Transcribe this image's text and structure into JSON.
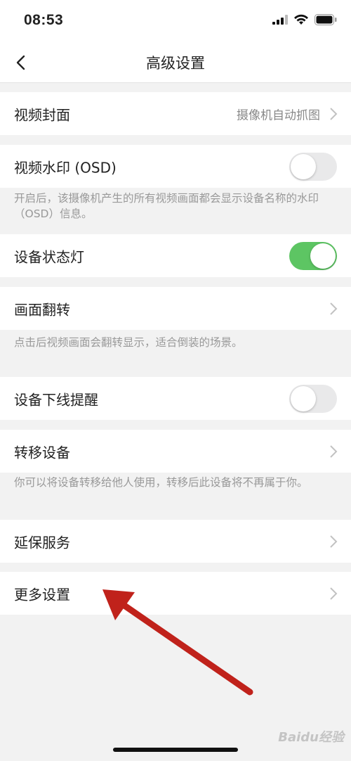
{
  "status_bar": {
    "time": "08:53"
  },
  "nav": {
    "title": "高级设置"
  },
  "rows": {
    "cover": {
      "label": "视频封面",
      "value": "摄像机自动抓图"
    },
    "watermark": {
      "label": "视频水印 (OSD)",
      "enabled": false,
      "note": "开启后，该摄像机产生的所有视频画面都会显示设备名称的水印（OSD）信息。"
    },
    "status_light": {
      "label": "设备状态灯",
      "enabled": true
    },
    "flip": {
      "label": "画面翻转",
      "note": "点击后视频画面会翻转显示，适合倒装的场景。"
    },
    "offline_alert": {
      "label": "设备下线提醒",
      "enabled": false
    },
    "transfer": {
      "label": "转移设备",
      "note": "你可以将设备转移给他人使用，转移后此设备将不再属于你。"
    },
    "warranty": {
      "label": "延保服务"
    },
    "more": {
      "label": "更多设置"
    }
  },
  "watermark_logo": "Baidu经验",
  "colors": {
    "toggle_on": "#5dc563",
    "toggle_off": "#e9e9ea",
    "arrow": "#c0221b"
  }
}
